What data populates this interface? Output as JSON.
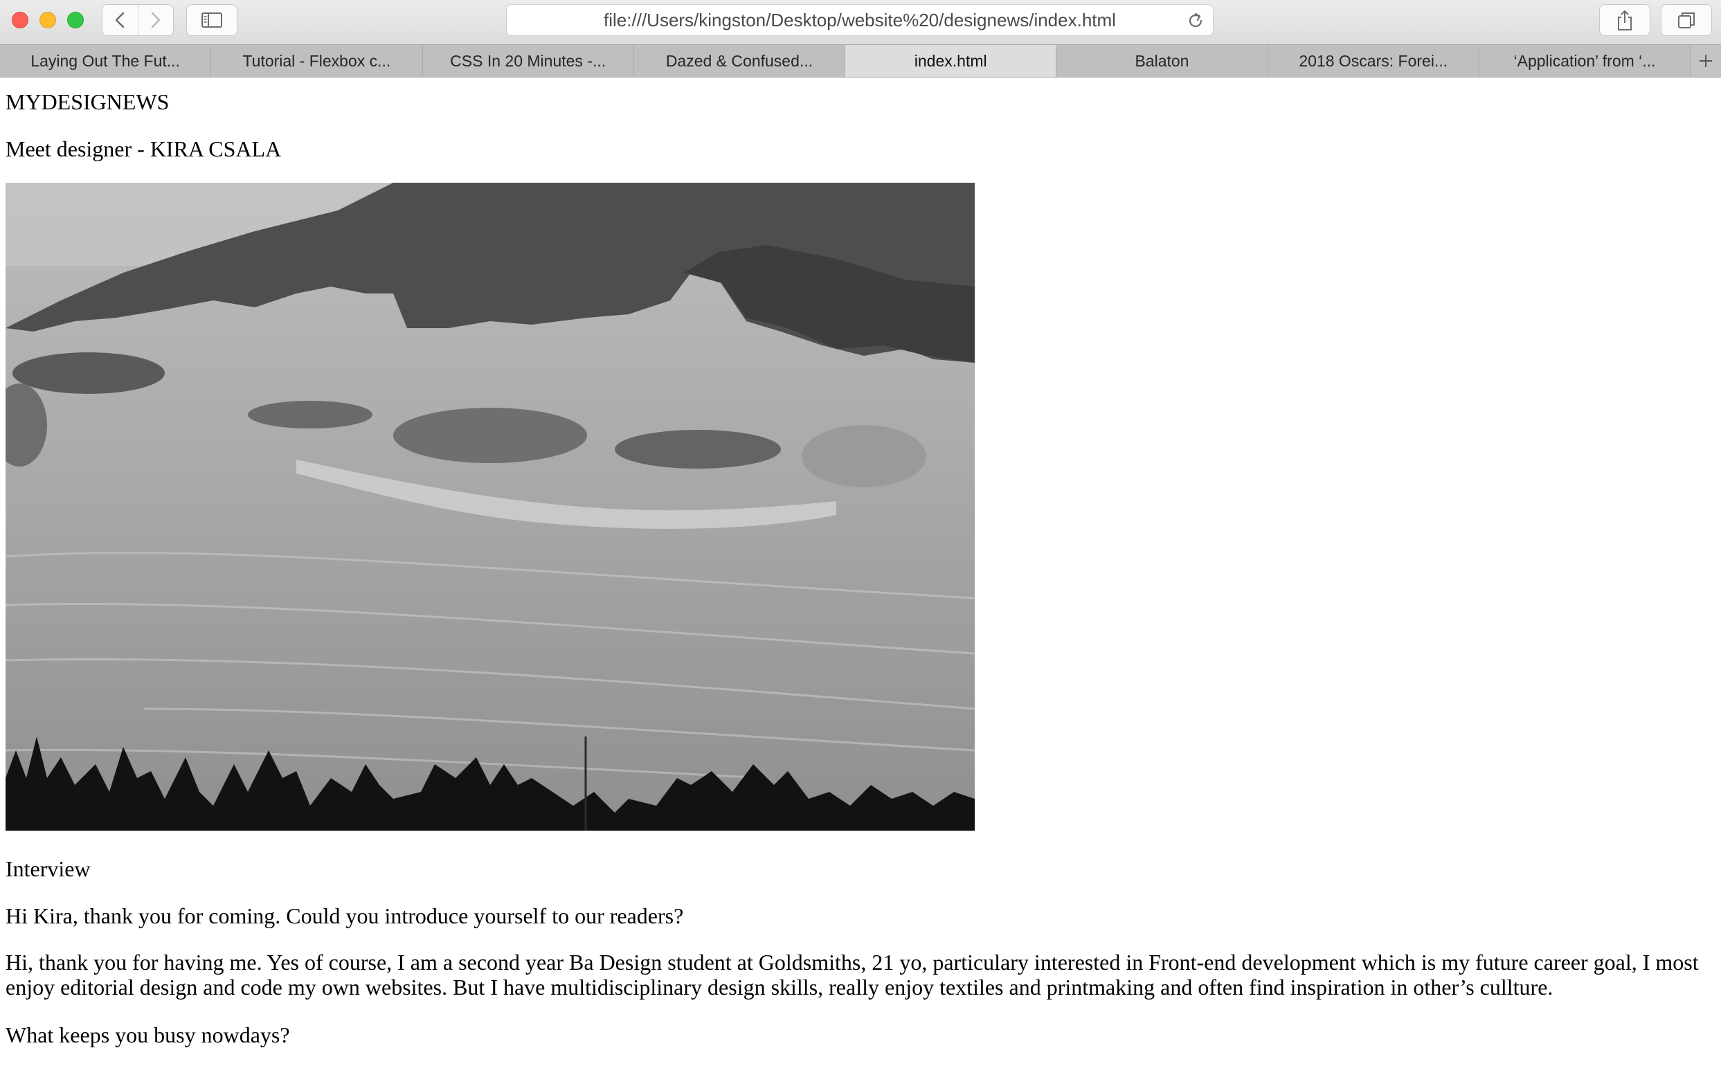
{
  "toolbar": {
    "url": "file:///Users/kingston/Desktop/website%20/designews/index.html",
    "icons": [
      "back-arrow-icon",
      "forward-arrow-icon",
      "sidebar-icon",
      "reload-icon",
      "share-icon",
      "tabs-overview-icon"
    ]
  },
  "tabs": [
    {
      "label": "Laying Out The Fut..."
    },
    {
      "label": "Tutorial - Flexbox c..."
    },
    {
      "label": "CSS In 20 Minutes -..."
    },
    {
      "label": "Dazed & Confused..."
    },
    {
      "label": "index.html"
    },
    {
      "label": "Balaton"
    },
    {
      "label": "2018 Oscars: Forei..."
    },
    {
      "label": "‘Application’ from ‘..."
    }
  ],
  "active_tab": "index.html",
  "page": {
    "site_title": "MYDESIGNEWS",
    "subtitle": "Meet designer - KIRA CSALA",
    "section_heading": "Interview",
    "question1": "Hi Kira, thank you for coming. Could you introduce yourself to our readers?",
    "answer1": "Hi, thank you for having me. Yes of course, I am a second year Ba Design student at Goldsmiths, 21 yo, particulary interested in Front-end development which is my future career goal, I most enjoy editorial design and code my own websites. But I have multidisciplinary design skills, really enjoy textiles and printmaking and often find inspiration in other’s cullture.",
    "question2": "What keeps you busy nowdays?"
  },
  "colors": {
    "close": "#fc5f57",
    "minimize": "#fdbc2e",
    "zoom": "#33c748",
    "tab_bar": "#c4c4c4",
    "active_tab": "#dddddd"
  }
}
